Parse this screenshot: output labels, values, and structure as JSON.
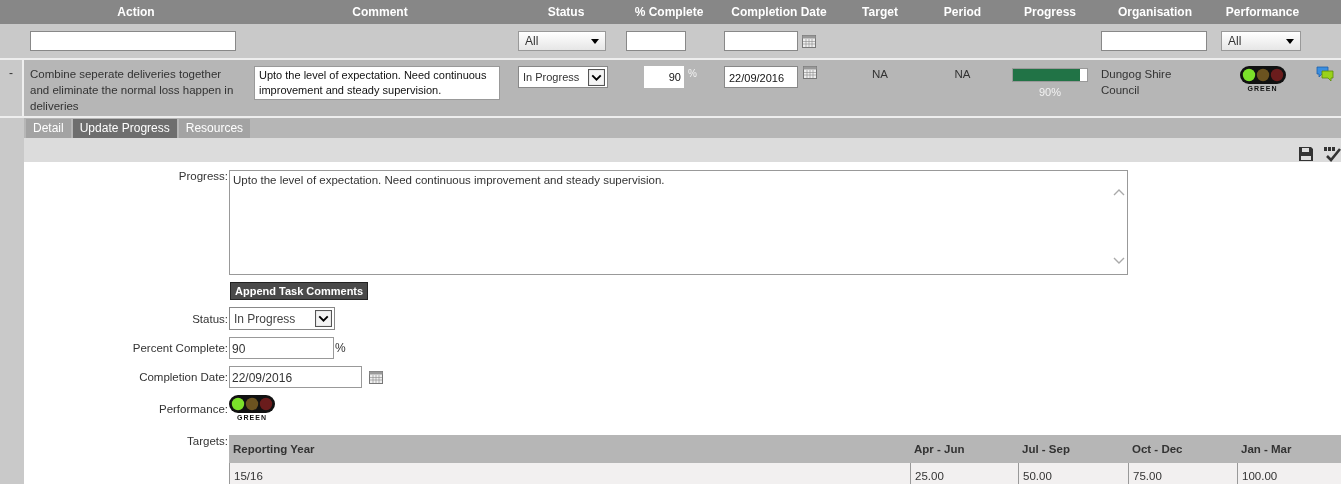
{
  "columns": [
    "Action",
    "Comment",
    "Status",
    "% Complete",
    "Completion Date",
    "Target",
    "Period",
    "Progress",
    "Organisation",
    "Performance"
  ],
  "filters": {
    "status": {
      "value": "All"
    },
    "performance": {
      "value": "All"
    }
  },
  "row": {
    "expand": "-",
    "expanded": true,
    "action": "Combine seperate deliveries together and eliminate the normal loss happen in deliveries",
    "comment": "Upto the level of expectation. Need continuous improvement and steady supervision.",
    "status": "In Progress",
    "percent": "90",
    "percent_unit": "%",
    "completion_date": "22/09/2016",
    "target": "NA",
    "period": "NA",
    "progress": {
      "level": 0.9,
      "reading": "90%"
    },
    "organisation": "Dungog Shire Council",
    "performance": {
      "lights": [
        {
          "on": true
        },
        {
          "on": false
        },
        {
          "on": false
        }
      ],
      "label": "GREEN"
    }
  },
  "tabs": [
    {
      "label": "Detail",
      "selected": false
    },
    {
      "label": "Update Progress",
      "selected": true
    },
    {
      "label": "Resources",
      "selected": false
    }
  ],
  "form": {
    "progress_label": "Progress:",
    "progress": "Upto the level of expectation. Need continuous improvement and steady supervision.",
    "append_button": "Append Task Comments",
    "status_label": "Status:",
    "status": "In Progress",
    "percent_label": "Percent Complete:",
    "percent": "90",
    "percent_unit": "%",
    "date_label": "Completion Date:",
    "date": "22/09/2016",
    "performance_label": "Performance:",
    "performance": {
      "lights": [
        {
          "on": true
        },
        {
          "on": false
        },
        {
          "on": false
        }
      ],
      "label": "GREEN"
    },
    "targets_label": "Targets:"
  },
  "targets": {
    "columns": [
      "Reporting Year",
      "Apr - Jun",
      "Jul - Sep",
      "Oct - Dec",
      "Jan - Mar"
    ],
    "rows": [
      [
        "15/16",
        "25.00",
        "50.00",
        "75.00",
        "100.00"
      ]
    ]
  }
}
